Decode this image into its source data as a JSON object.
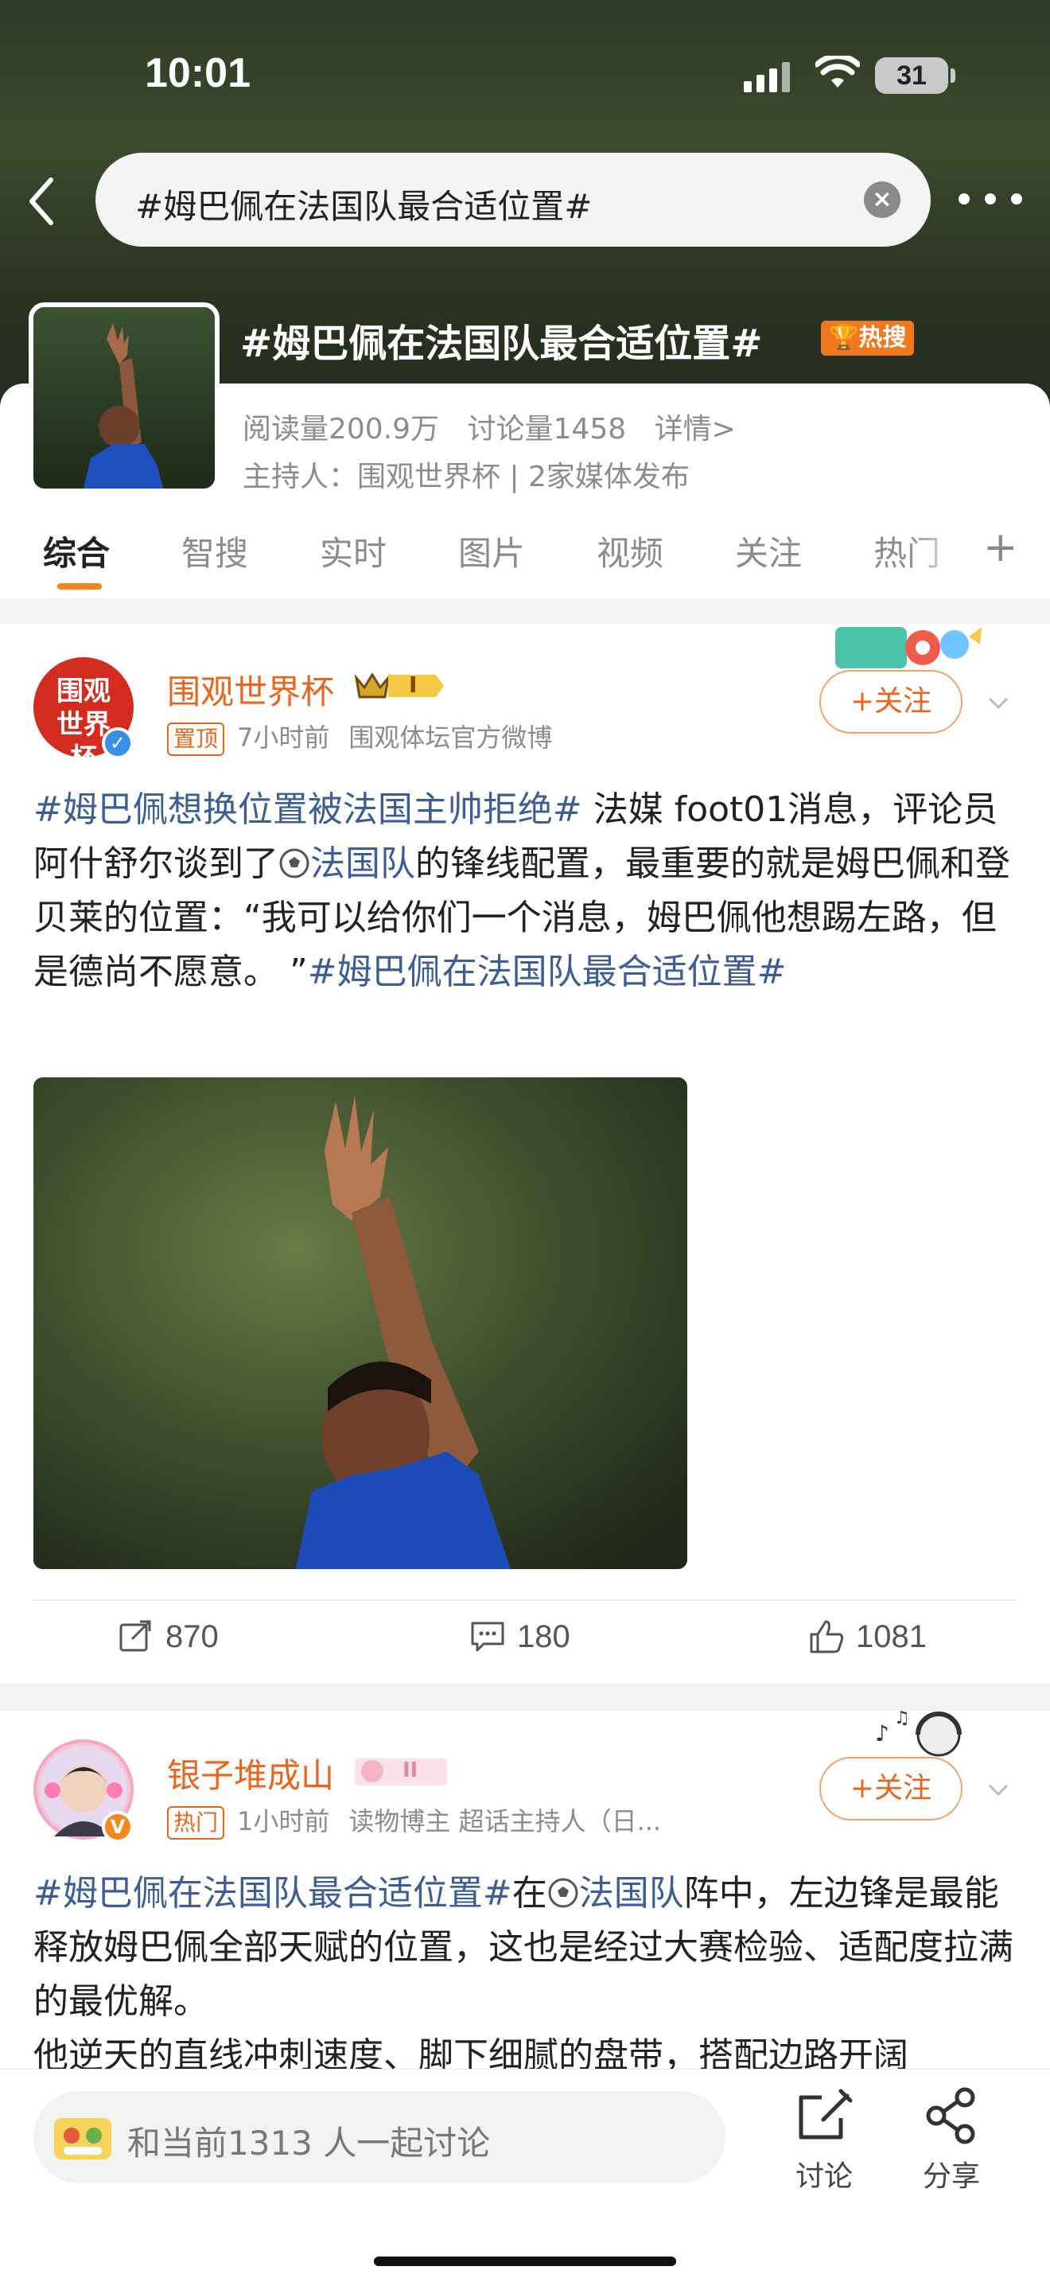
{
  "status_bar": {
    "time": "10:01",
    "battery": "31"
  },
  "search": {
    "query": "#姆巴佩在法国队最合适位置#"
  },
  "topic": {
    "title": "#姆巴佩在法国队最合适位置#",
    "hot_badge": "热搜",
    "reads": "阅读量200.9万",
    "discussions": "讨论量1458",
    "details": "详情>",
    "host": "主持人：围观世界杯 | 2家媒体发布"
  },
  "tabs": [
    "综合",
    "智搜",
    "实时",
    "图片",
    "视频",
    "关注",
    "热门"
  ],
  "posts": [
    {
      "author": "围观世界杯",
      "avatar_text": "围观世界杯",
      "level_badge": "I",
      "tag": "置顶",
      "time": "7小时前",
      "source": "围观体坛官方微博",
      "follow": "+关注",
      "body": {
        "topic1": "#姆巴佩想换位置被法国主帅拒绝#",
        "text1": " 法媒 foot01消息，评论员阿什舒尔谈到了",
        "topic2": "法国队",
        "text2": "的锋线配置，最重要的就是姆巴佩和登贝莱的位置：“我可以给你们一个消息，姆巴佩他想踢左路，但是德尚不愿意。 ”",
        "topic3": "#姆巴佩在法国队最合适位置#"
      },
      "reposts": "870",
      "comments": "180",
      "likes": "1081"
    },
    {
      "author": "银子堆成山",
      "level_badge": "II",
      "tag": "热门",
      "time": "1小时前",
      "source": "读物博主 超话主持人（日...",
      "follow": "+关注",
      "body": {
        "topic1": "#姆巴佩在法国队最合适位置#",
        "text1": "在",
        "topic2": "法国队",
        "text2": "阵中，左边锋是最能释放姆巴佩全部天赋的位置，这也是经过大赛检验、适配度拉满的最优解。",
        "text3": "他逆天的直线冲刺速度、脚下细腻的盘带，搭配边路开阔"
      }
    }
  ],
  "bottom": {
    "input_text": "和当前1313 人一起讨论",
    "discuss": "讨论",
    "share": "分享"
  },
  "colors": {
    "accent": "#e8651b",
    "topic_link": "#3d5e94",
    "hot": "#f2781e"
  }
}
